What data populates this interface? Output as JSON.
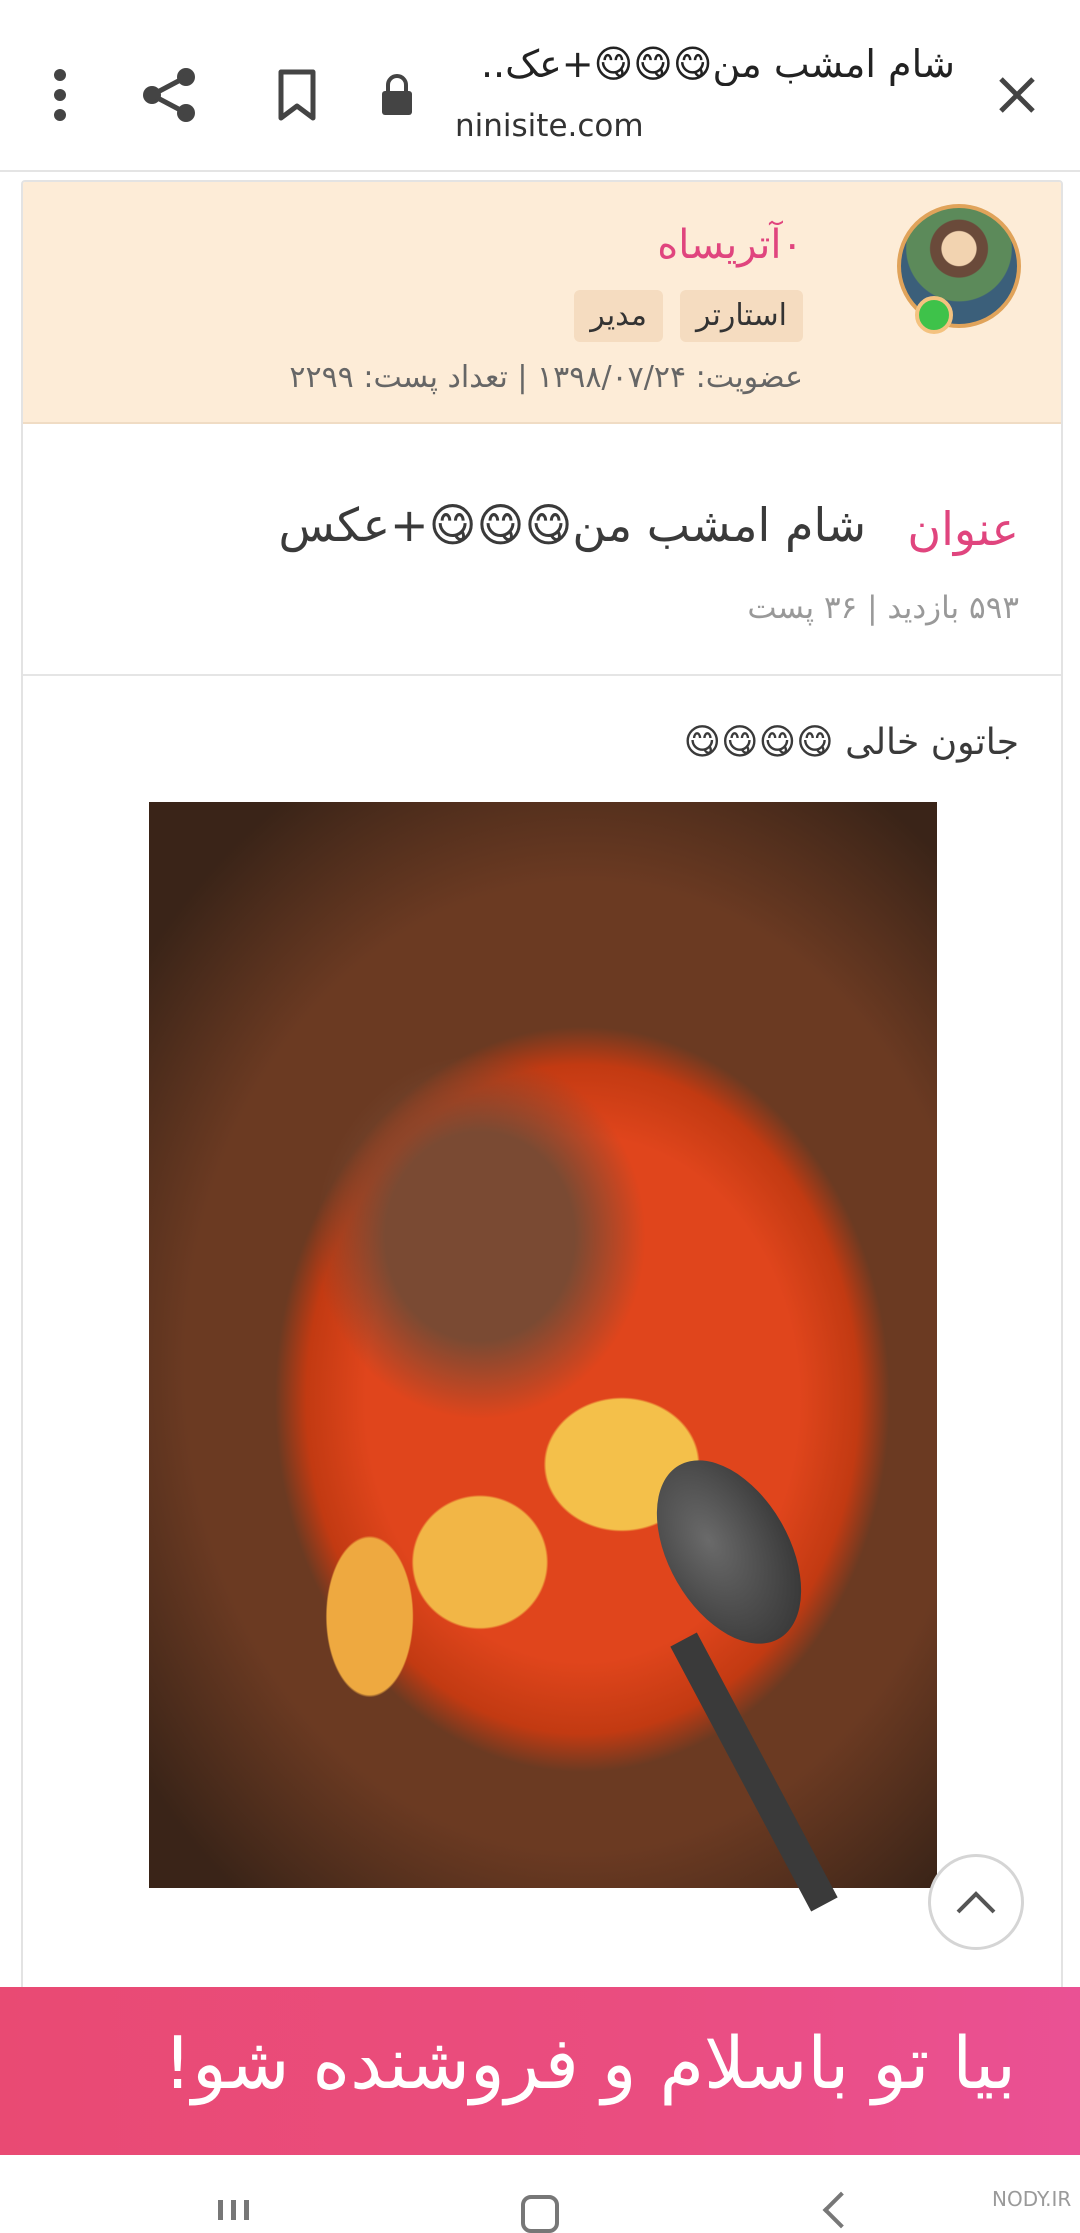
{
  "browser": {
    "page_title": "شام امشب من😋😋😋+عک..",
    "url": "ninisite.com",
    "icons": [
      "close-icon",
      "lock-icon",
      "bookmark-icon",
      "share-icon",
      "more-vert-icon"
    ]
  },
  "author": {
    "name": "۰آتریساه",
    "badges": [
      "استارتر",
      "مدیر"
    ],
    "membership": "عضویت: ۱۳۹۸/۰۷/۲۴ | تعداد پست: ۲۲۹۹",
    "status": "online"
  },
  "topic": {
    "label": "عنوان",
    "title": "شام امشب من😋😋😋+عکس",
    "stats": "۵۹۳ بازدید   | ۳۶ پست"
  },
  "post": {
    "text": "جاتون خالی 😋😋😋😋",
    "image_alt": "food-photo"
  },
  "banner": {
    "text": "بیا تو باسلام و فروشنده شو!"
  },
  "watermark": "NODY.IR",
  "colors": {
    "accent_pink": "#e0457e",
    "author_bg": "#fdecd7",
    "banner_pink": "#ea4d80",
    "online_green": "#3ec24a"
  }
}
